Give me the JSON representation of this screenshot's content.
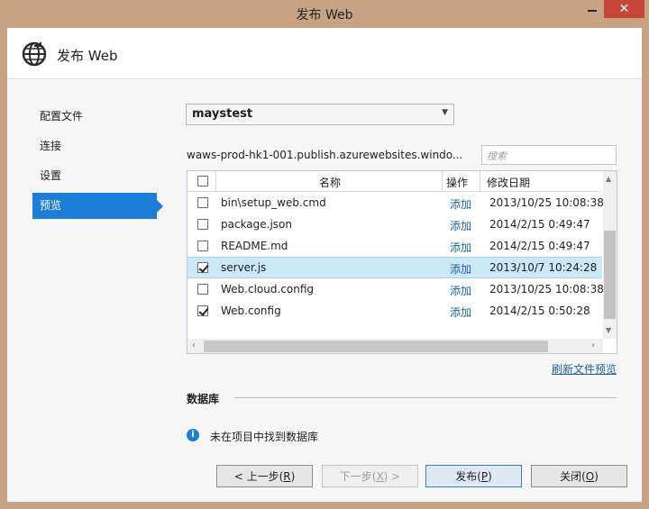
{
  "window": {
    "title": "发布 Web",
    "close_glyph": "✕"
  },
  "header": {
    "title": "发布 Web",
    "icon": "globe-publish-icon"
  },
  "nav": {
    "items": [
      {
        "label": "配置文件",
        "active": false
      },
      {
        "label": "连接",
        "active": false
      },
      {
        "label": "设置",
        "active": false
      },
      {
        "label": "预览",
        "active": true
      }
    ]
  },
  "profile": {
    "selected": "maystest"
  },
  "site": {
    "url": "waws-prod-hk1-001.publish.azurewebsites.windo..."
  },
  "search": {
    "placeholder": "搜索"
  },
  "grid": {
    "columns": {
      "name": "名称",
      "action": "操作",
      "modified": "修改日期"
    },
    "rows": [
      {
        "name": "bin\\setup_web.cmd",
        "action": "添加",
        "date": "2013/10/25 10:08:38",
        "checked": false,
        "selected": false
      },
      {
        "name": "package.json",
        "action": "添加",
        "date": "2014/2/15 0:49:47",
        "checked": false,
        "selected": false
      },
      {
        "name": "README.md",
        "action": "添加",
        "date": "2014/2/15 0:49:47",
        "checked": false,
        "selected": false
      },
      {
        "name": "server.js",
        "action": "添加",
        "date": "2013/10/7 10:24:28",
        "checked": true,
        "selected": true
      },
      {
        "name": "Web.cloud.config",
        "action": "添加",
        "date": "2013/10/25 10:08:38",
        "checked": false,
        "selected": false
      },
      {
        "name": "Web.config",
        "action": "添加",
        "date": "2014/2/15 0:50:28",
        "checked": true,
        "selected": false
      }
    ]
  },
  "refresh_link": "刷新文件预览",
  "database": {
    "section_label": "数据库",
    "message": "未在项目中找到数据库",
    "info_glyph": "i"
  },
  "buttons": {
    "prev": {
      "text": "< 上一步(",
      "key": "R",
      "end": ")"
    },
    "next": {
      "text": "下一步(",
      "key": "X",
      "end": ") >"
    },
    "publish": {
      "text": "发布(",
      "key": "P",
      "end": ")"
    },
    "close": {
      "text": "关闭(",
      "key": "O",
      "end": ")"
    }
  },
  "colors": {
    "accent": "#1c7ed6",
    "frame": "#c7a283",
    "close_button": "#c7463a",
    "selected_row": "#cbe8f6"
  }
}
